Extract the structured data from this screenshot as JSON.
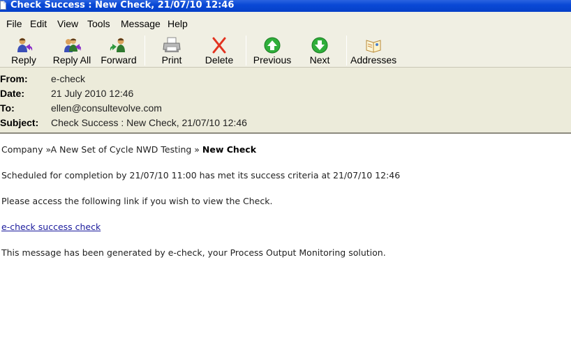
{
  "window": {
    "title": "Check Success : New Check, 21/07/10 12:46"
  },
  "menu": {
    "items": [
      "File",
      "Edit",
      "View",
      "Tools",
      "Message",
      "Help"
    ]
  },
  "toolbar": {
    "buttons": [
      {
        "label": "Reply",
        "icon": "reply-icon"
      },
      {
        "label": "Reply All",
        "icon": "reply-all-icon"
      },
      {
        "label": "Forward",
        "icon": "forward-icon"
      },
      {
        "label": "Print",
        "icon": "print-icon"
      },
      {
        "label": "Delete",
        "icon": "delete-icon"
      },
      {
        "label": "Previous",
        "icon": "previous-icon"
      },
      {
        "label": "Next",
        "icon": "next-icon"
      },
      {
        "label": "Addresses",
        "icon": "addresses-icon"
      }
    ]
  },
  "header": {
    "from_label": "From:",
    "from_value": "e-check",
    "date_label": "Date:",
    "date_value": "21 July 2010 12:46",
    "to_label": "To:",
    "to_value": "ellen@consultevolve.com",
    "subject_label": "Subject:",
    "subject_value": "Check Success : New Check, 21/07/10 12:46"
  },
  "body": {
    "breadcrumb_prefix": "Company »A New Set of Cycle NWD Testing » ",
    "breadcrumb_current": "New Check",
    "scheduled_line": "Scheduled for completion by 21/07/10 11:00 has met its success criteria at 21/07/10 12:46",
    "access_line": "Please access the following link if you wish to view the Check.",
    "link_text": "e-check success check",
    "footer_line": "This message has been generated by e-check, your Process Output Monitoring solution."
  },
  "colors": {
    "titlebar": "#0a49d6",
    "chrome": "#f0efe3",
    "header_panel": "#ecebda",
    "link": "#1a1a9c"
  }
}
